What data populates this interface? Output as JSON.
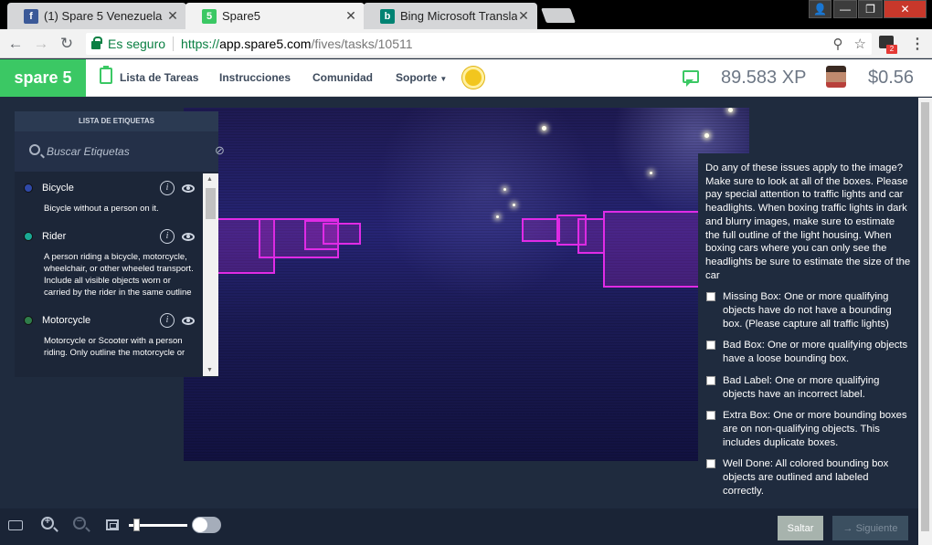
{
  "browser": {
    "tabs": [
      {
        "label": "(1) Spare 5 Venezuela",
        "icon": "facebook-icon",
        "color": "#3b5998",
        "glyph": "f"
      },
      {
        "label": "Spare5",
        "icon": "spare5-icon",
        "color": "#3bc864",
        "glyph": "5"
      },
      {
        "label": "Bing Microsoft Translato",
        "icon": "bing-icon",
        "color": "#008373",
        "glyph": "b"
      }
    ],
    "secure_label": "Es seguro",
    "url": {
      "scheme": "https://",
      "host": "app.spare5.com",
      "path": "/fives/tasks/10511"
    },
    "extension_badge": "2"
  },
  "app": {
    "logo": "spare 5",
    "nav": {
      "tasks": "Lista de Tareas",
      "instructions": "Instrucciones",
      "community": "Comunidad",
      "support": "Soporte"
    },
    "xp": "89.583 XP",
    "balance": "$0.56",
    "accent": "#3bc864"
  },
  "labels_panel": {
    "title": "LISTA DE ETIQUETAS",
    "search_placeholder": "Buscar Etiquetas",
    "items": [
      {
        "name": "Bicycle",
        "color": "#2f49a8",
        "description": "Bicycle without a person on it."
      },
      {
        "name": "Rider",
        "color": "#1aa894",
        "description": "A person riding a bicycle, motorcycle, wheelchair, or other wheeled transport. Include all visible objects worn or carried by the rider in the same outline"
      },
      {
        "name": "Motorcycle",
        "color": "#2f7d4a",
        "description": "Motorcycle or Scooter with a person riding. Only outline the motorcycle or"
      }
    ]
  },
  "question": {
    "prompt": "Do any of these issues apply to the image? Make sure to look at all of the boxes. Please pay special attention to traffic lights and car headlights. When boxing traffic lights in dark and blurry images, make sure to estimate the full outline of the light housing. When boxing cars where you can only see the headlights be sure to estimate the size of the car",
    "options": [
      {
        "label": "Missing Box: One or more qualifying objects have do not have a bounding box. (Please capture all traffic lights)",
        "checked": false
      },
      {
        "label": "Bad Box: One or more qualifying objects have a loose bounding box.",
        "checked": false
      },
      {
        "label": "Bad Label: One or more qualifying objects have an incorrect label.",
        "checked": false
      },
      {
        "label": "Extra Box: One or more bounding boxes are on non-qualifying objects. This includes duplicate boxes.",
        "checked": false
      },
      {
        "label": "Well Done: All colored bounding box objects are outlined and labeled correctly.",
        "checked": false
      }
    ]
  },
  "footer": {
    "skip": "Saltar",
    "next": "→ Siguiente"
  }
}
